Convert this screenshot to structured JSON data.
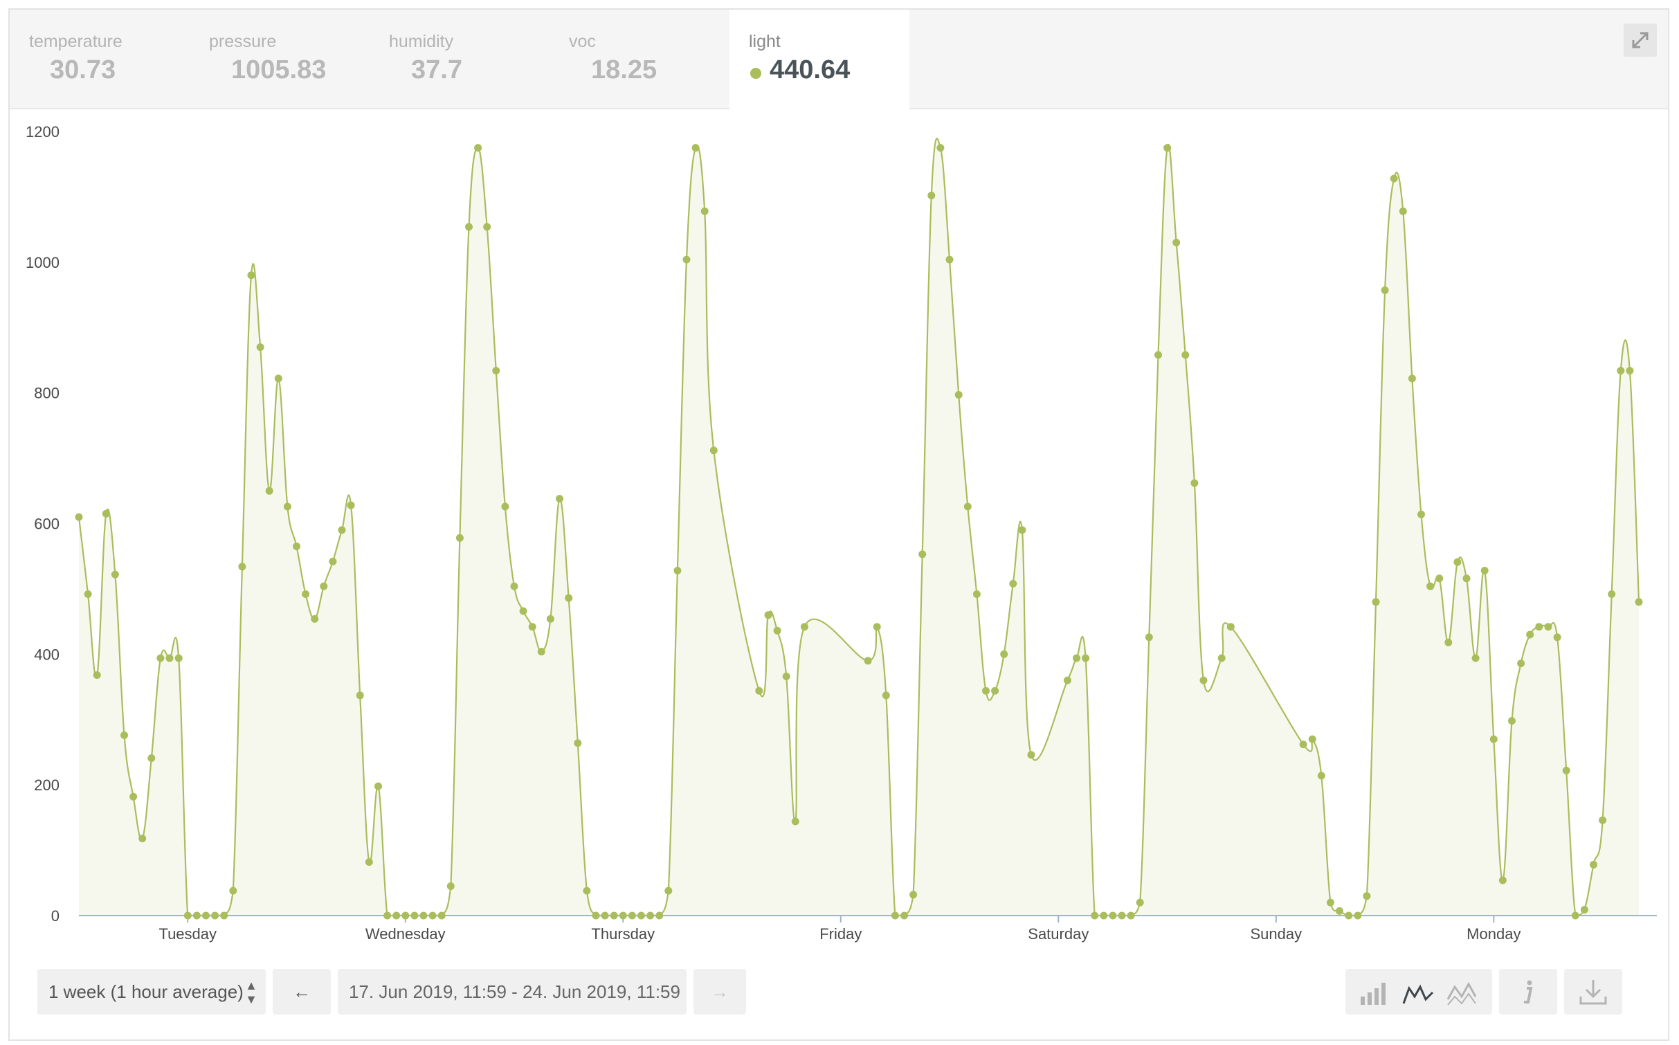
{
  "tabs": [
    {
      "name": "temperature",
      "value": "30.73",
      "active": false
    },
    {
      "name": "pressure",
      "value": "1005.83",
      "active": false
    },
    {
      "name": "humidity",
      "value": "37.7",
      "active": false
    },
    {
      "name": "voc",
      "value": "18.25",
      "active": false
    },
    {
      "name": "light",
      "value": "440.64",
      "active": true
    }
  ],
  "icons": {
    "expand": "expand-icon",
    "bar_chart": "bar-chart-icon",
    "line_chart": "line-chart-icon",
    "area_chart": "area-chart-icon",
    "info": "info-icon",
    "download": "download-icon"
  },
  "controls": {
    "period": "1 week (1 hour average)",
    "prev_arrow": "←",
    "date_range": "17. Jun 2019, 11:59 - 24. Jun 2019, 11:59",
    "next_arrow": "→"
  },
  "colors": {
    "series": "#aabd5c",
    "fill": "#f6f8ee",
    "axis": "#9fb6c4"
  },
  "chart_data": {
    "type": "area",
    "series": [
      {
        "name": "light",
        "x_start": "17. Jun 2019, 12:00",
        "x_step_hours": 1,
        "values": [
          610,
          492,
          368,
          615,
          522,
          276,
          182,
          118,
          241,
          394,
          394,
          394,
          0,
          0,
          0,
          0,
          0,
          38,
          534,
          980,
          870,
          650,
          822,
          626,
          565,
          492,
          454,
          504,
          542,
          590,
          628,
          337,
          82,
          198,
          0,
          0,
          0,
          0,
          0,
          0,
          0,
          45,
          578,
          1054,
          1175,
          1054,
          834,
          626,
          504,
          466,
          442,
          404,
          454,
          638,
          486,
          264,
          38,
          0,
          0,
          0,
          0,
          0,
          0,
          0,
          0,
          38,
          528,
          1004,
          1175,
          1078,
          712,
          null,
          null,
          null,
          null,
          344,
          460,
          436,
          366,
          144,
          442,
          null,
          null,
          null,
          null,
          null,
          null,
          390,
          442,
          337,
          0,
          0,
          32,
          553,
          1102,
          1175,
          1004,
          797,
          626,
          492,
          344,
          344,
          400,
          508,
          590,
          246,
          null,
          null,
          null,
          360,
          394,
          394,
          0,
          0,
          0,
          0,
          0,
          20,
          426,
          858,
          1175,
          1030,
          858,
          662,
          360,
          null,
          394,
          442,
          null,
          null,
          null,
          null,
          null,
          null,
          null,
          262,
          270,
          214,
          20,
          7,
          0,
          0,
          30,
          480,
          957,
          1128,
          1078,
          822,
          614,
          504,
          516,
          418,
          541,
          516,
          394,
          528,
          270,
          54,
          298,
          386,
          430,
          442,
          442,
          426,
          222,
          0,
          9,
          78,
          146,
          492,
          834,
          834,
          480
        ]
      }
    ],
    "xticks": [
      "Tuesday",
      "Wednesday",
      "Thursday",
      "Friday",
      "Saturday",
      "Sunday",
      "Monday"
    ],
    "ylim": [
      0,
      1200
    ],
    "yticks": [
      0,
      200,
      400,
      600,
      800,
      1000,
      1200
    ],
    "grid": false
  }
}
